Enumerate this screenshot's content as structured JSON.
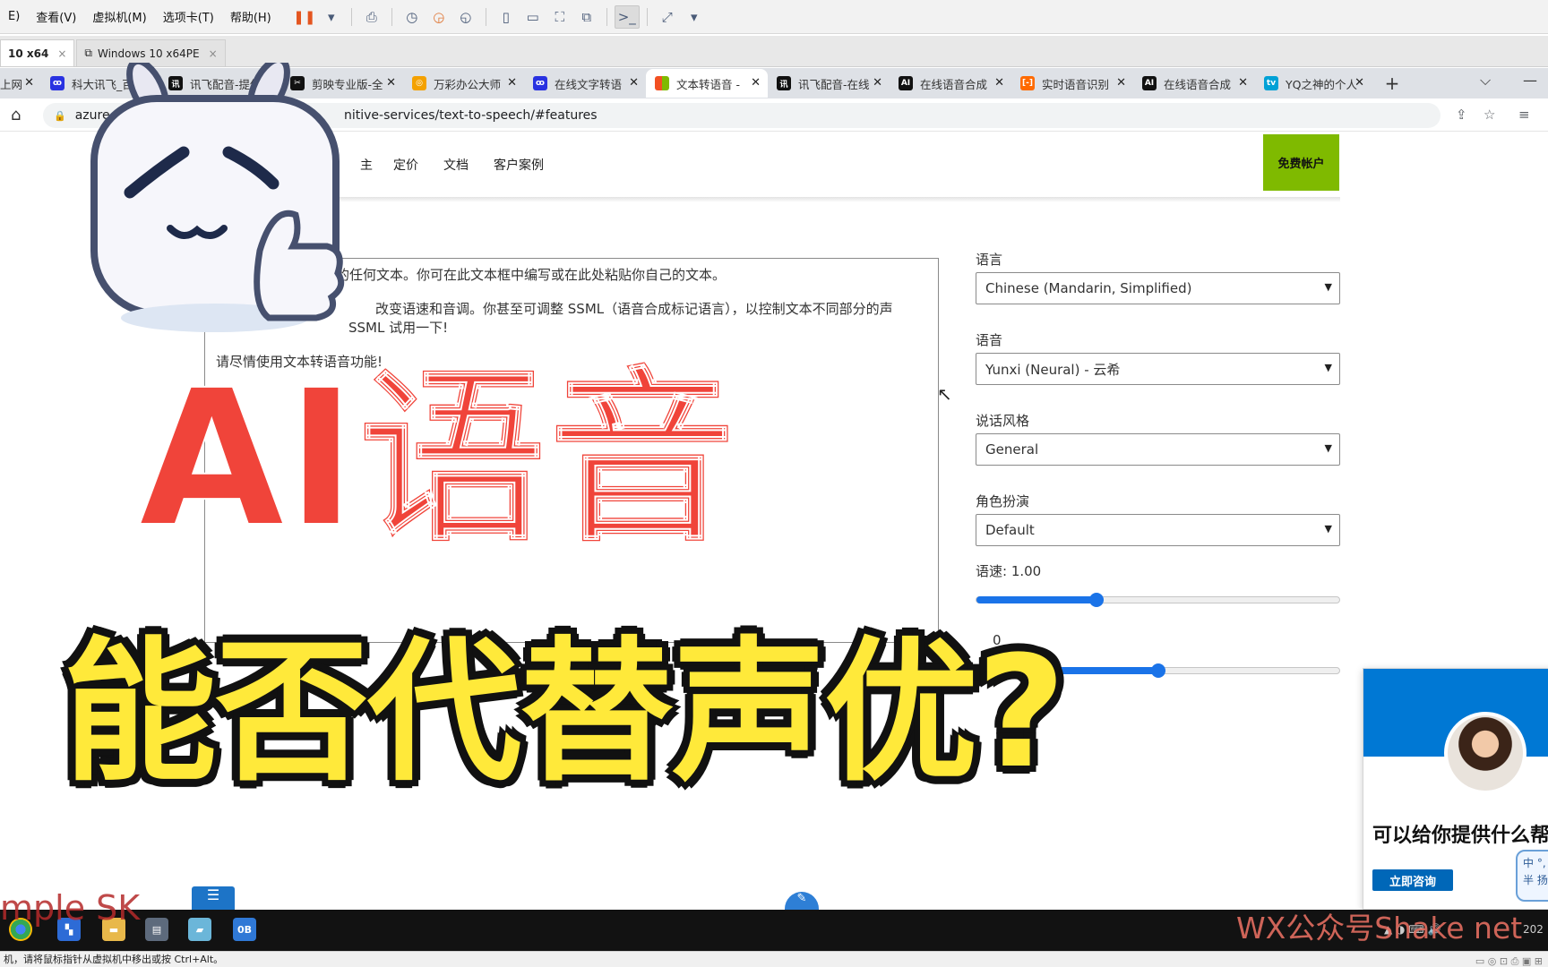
{
  "vm_menubar": {
    "menus": [
      "E)",
      "查看(V)",
      "虚拟机(M)",
      "选项卡(T)",
      "帮助(H)"
    ],
    "tool_icons": [
      "pause-icon",
      "send-keys-icon",
      "snapshot-icon",
      "revert-snapshot-icon",
      "snapshot-manager-icon",
      "sidebar-icon",
      "console-icon",
      "fullscreen-icon",
      "unity-icon",
      "terminal-icon",
      "stretch-icon"
    ]
  },
  "vm_tabs": [
    {
      "label": "10 x64",
      "active": true,
      "close": "×"
    },
    {
      "label": "Windows 10 x64PE",
      "active": false,
      "close": "×"
    }
  ],
  "browser_tabs": [
    {
      "label": "上网",
      "icon": "generic-tab-icon",
      "color": "#5f6368",
      "active": false
    },
    {
      "label": "科大讯飞_百度",
      "icon": "baidu-paw-icon",
      "color": "#2932e1",
      "active": false
    },
    {
      "label": "讯飞配音-提供",
      "icon": "xunfei-icon",
      "color": "#111111",
      "active": false
    },
    {
      "label": "剪映专业版-全",
      "icon": "capcut-icon",
      "color": "#111111",
      "active": false
    },
    {
      "label": "万彩办公大师",
      "icon": "wancai-icon",
      "color": "#f4a100",
      "active": false
    },
    {
      "label": "在线文字转语",
      "icon": "baidu-paw-icon",
      "color": "#2932e1",
      "active": false
    },
    {
      "label": "文本转语音 -",
      "icon": "microsoft-icon",
      "color": "#f25022",
      "active": true
    },
    {
      "label": "讯飞配音-在线",
      "icon": "xunfei-icon",
      "color": "#111111",
      "active": false
    },
    {
      "label": "在线语音合成",
      "icon": "ai-icon",
      "color": "#111111",
      "active": false
    },
    {
      "label": "实时语音识别",
      "icon": "aliyun-icon",
      "color": "#ff6a00",
      "active": false
    },
    {
      "label": "在线语音合成",
      "icon": "ai-icon",
      "color": "#111111",
      "active": false
    },
    {
      "label": "YQ之神的个人",
      "icon": "bilibili-icon",
      "color": "#00a1d6",
      "active": false
    }
  ],
  "address_bar": {
    "url_start": "azure.micr",
    "url_end": "nitive-services/text-to-speech/#features"
  },
  "azure_nav": {
    "links": [
      "定价",
      "文档",
      "客户案例"
    ],
    "free_account": "免费帐户",
    "partial_char": "主"
  },
  "textarea": {
    "line1": "的任何文本。你可在此文本框中编写或在此处粘贴你自己的文本。",
    "line2a": "改变语速和音调。你甚至可调整 SSML（语音合成标记语言），以控制文本不同部分的声",
    "line2b": "SSML 试用一下!",
    "line3": "请尽情使用文本转语音功能!"
  },
  "form": {
    "language_label": "语言",
    "language_value": "Chinese (Mandarin, Simplified)",
    "voice_label": "语音",
    "voice_value": "Yunxi (Neural) - 云希",
    "style_label": "说话风格",
    "style_value": "General",
    "role_label": "角色扮演",
    "role_value": "Default",
    "speed_label": "语速: 1.00",
    "speed_fraction": 0.33,
    "pitch_label_fragment": "0",
    "pitch_fraction": 0.5
  },
  "chat_widget": {
    "question": "可以给你提供什么帮",
    "cta": "立即咨询",
    "ime_text_1": "中 °,",
    "ime_text_2": "半 扬"
  },
  "overlay": {
    "headline_red": "AI语音",
    "headline_yellow": "能否代替声优?",
    "watermark_left": "mple SK",
    "watermark_right": "WX公众号Shake net",
    "red_color": "#f0443a",
    "yellow_color": "#ffe93a"
  },
  "taskbar": {
    "app_icons": [
      "chrome-icon",
      "app-icon",
      "file-explorer-icon",
      "folder-icon",
      "notepad-icon",
      "app-0b-icon"
    ],
    "app_0b_label": "0B"
  },
  "statusbar": {
    "text": "机，请将鼠标指针从虚拟机中移出或按 Ctrl+Alt。"
  }
}
